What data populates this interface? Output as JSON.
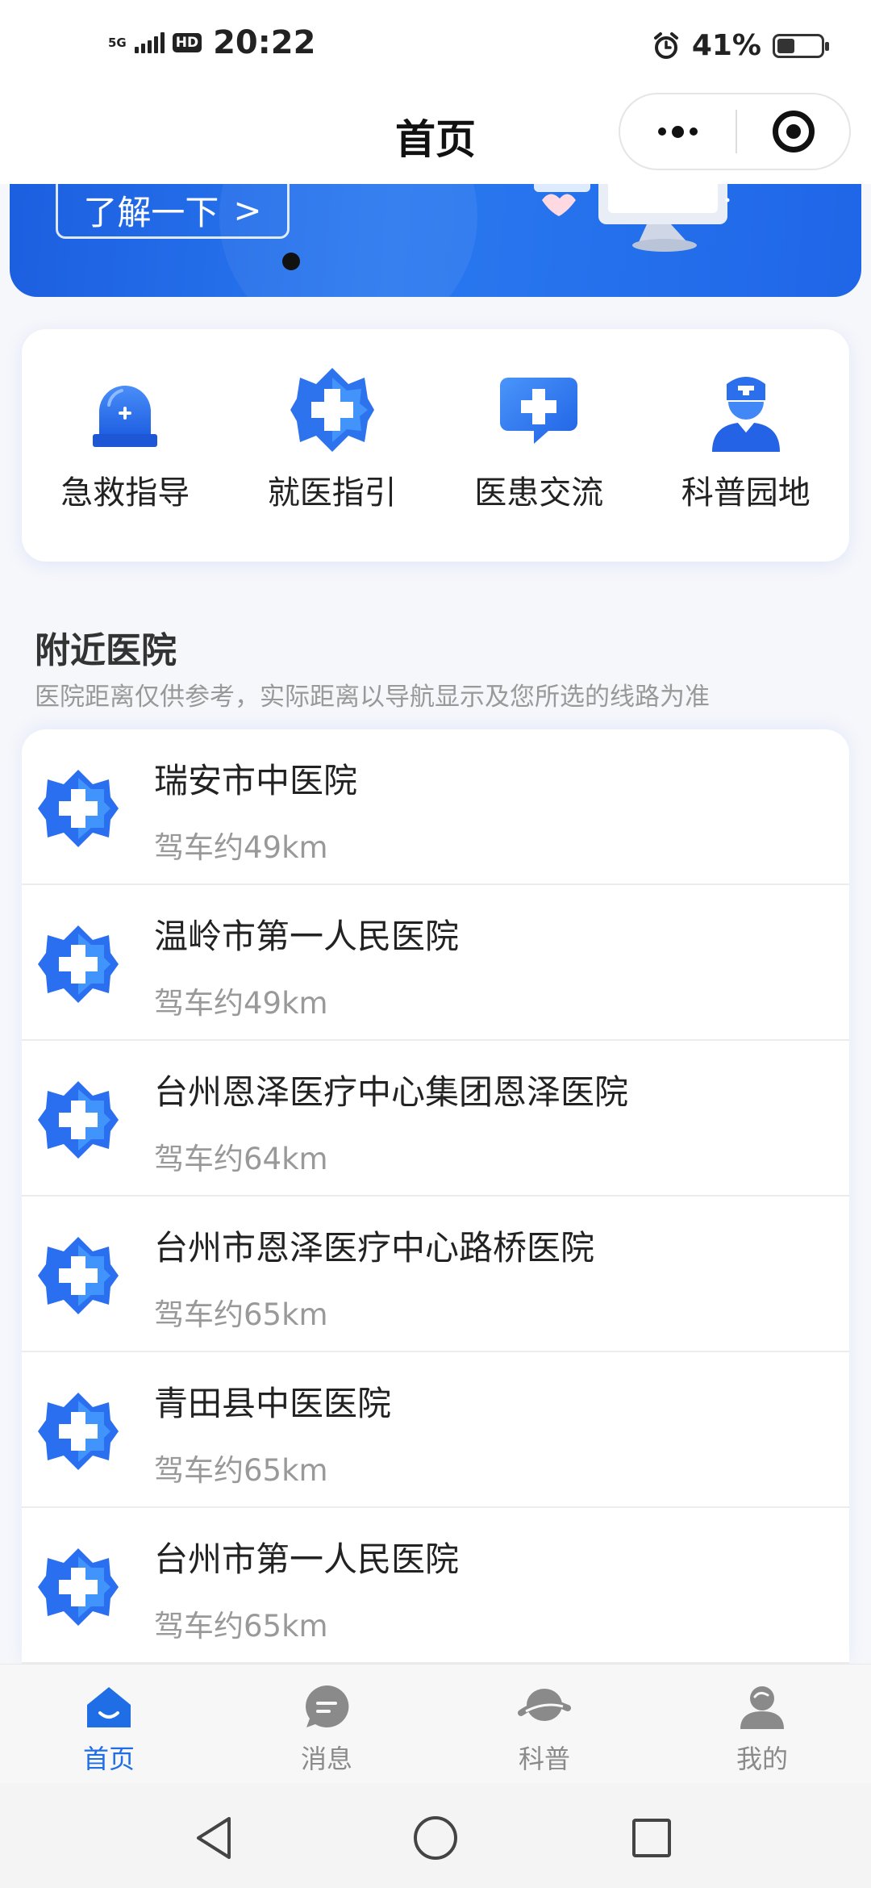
{
  "status_bar": {
    "network": "5G",
    "hd_badge": "HD",
    "time": "20:22",
    "battery_percent": "41%",
    "battery_level": 0.41
  },
  "nav": {
    "title": "首页"
  },
  "banner": {
    "button_label": "了解一下",
    "chevron": ">",
    "active_slide": 1,
    "colors": {
      "primary": "#1f66e8"
    }
  },
  "quick_menu": [
    {
      "label": "急救指导",
      "icon": "emergency-light-icon"
    },
    {
      "label": "就医指引",
      "icon": "medical-cross-icon"
    },
    {
      "label": "医患交流",
      "icon": "chat-cross-icon"
    },
    {
      "label": "科普园地",
      "icon": "nurse-icon"
    }
  ],
  "nearby": {
    "title": "附近医院",
    "subtitle": "医院距离仅供参考，实际距离以导航显示及您所选的线路为准",
    "hospitals": [
      {
        "name": "瑞安市中医院",
        "distance": "驾车约49km"
      },
      {
        "name": "温岭市第一人民医院",
        "distance": "驾车约49km"
      },
      {
        "name": "台州恩泽医疗中心集团恩泽医院",
        "distance": "驾车约64km"
      },
      {
        "name": "台州市恩泽医疗中心路桥医院",
        "distance": "驾车约65km"
      },
      {
        "name": "青田县中医医院",
        "distance": "驾车约65km"
      },
      {
        "name": "台州市第一人民医院",
        "distance": "驾车约65km"
      }
    ]
  },
  "tabbar": {
    "active_color": "#1f6ee6",
    "items": [
      {
        "label": "首页",
        "icon": "home-icon",
        "active": true
      },
      {
        "label": "消息",
        "icon": "message-icon",
        "active": false
      },
      {
        "label": "科普",
        "icon": "science-icon",
        "active": false
      },
      {
        "label": "我的",
        "icon": "profile-icon",
        "active": false
      }
    ]
  }
}
